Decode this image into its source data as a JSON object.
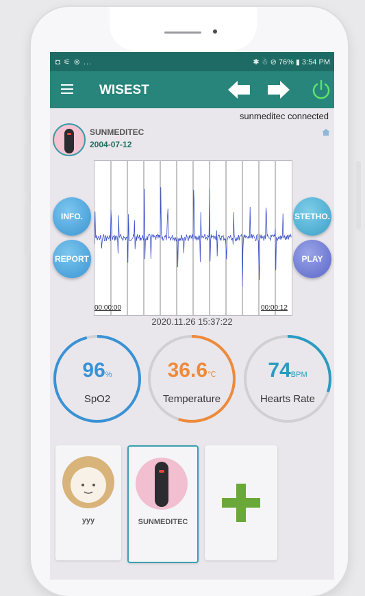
{
  "statusbar": {
    "left_icons": "◘ ⚟ ⊚ ...",
    "right_text": "✱ ☃ ⊘ 76% ▮ 3:54 PM"
  },
  "toolbar": {
    "title": "WISEST",
    "menu_icon": "hamburger-icon",
    "back_icon": "arrow-left-icon",
    "forward_icon": "arrow-right-icon",
    "power_icon": "power-icon"
  },
  "connection_status": "sunmeditec connected",
  "device": {
    "name": "SUNMEDITEC",
    "date": "2004-07-12"
  },
  "waveform": {
    "time_start": "00:00:00",
    "time_end": "00:00:12",
    "recorded_at": "2020.11.26 15:37:22",
    "color": "#3b4fc8"
  },
  "buttons": {
    "info": "INFO.",
    "report": "REPORT",
    "stetho": "STETHO.",
    "play": "PLAY"
  },
  "gauges": [
    {
      "value": "96",
      "unit": "%",
      "label": "SpO2",
      "color": "#3a92d5",
      "fraction": 0.96
    },
    {
      "value": "36.6",
      "unit": "℃",
      "label": "Temperature",
      "color": "#ee8a3a",
      "fraction": 0.55
    },
    {
      "value": "74",
      "unit": "BPM",
      "label": "Hearts Rate",
      "color": "#2a9bc0",
      "fraction": 0.3
    }
  ],
  "users": [
    {
      "name": "yyy"
    },
    {
      "name": "SUNMEDITEC"
    }
  ],
  "add_user_icon": "plus-icon"
}
